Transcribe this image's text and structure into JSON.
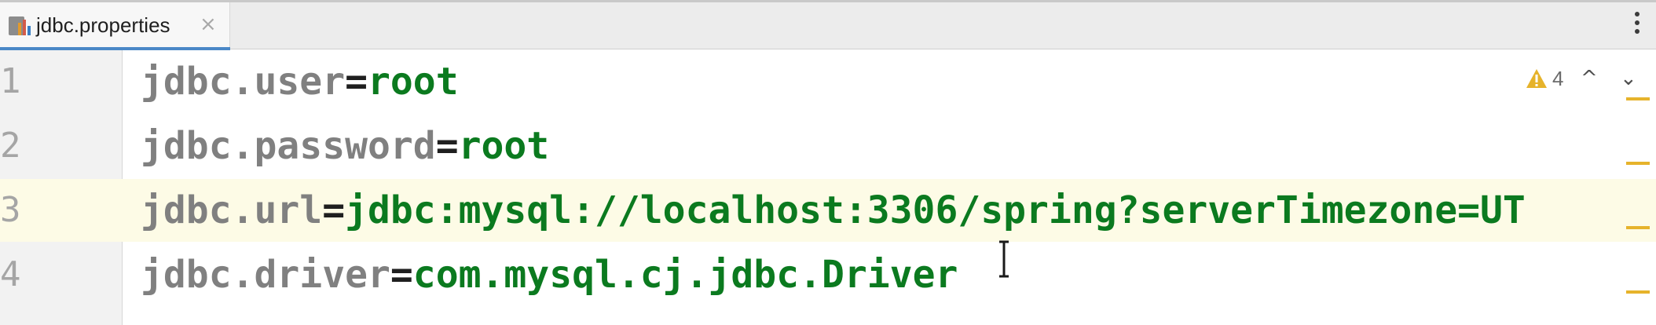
{
  "tab": {
    "title": "jdbc.properties",
    "close_glyph": "×",
    "icon": "properties-file-icon"
  },
  "toolbar": {
    "more_icon": "more-vertical-icon"
  },
  "inspection": {
    "warning_icon": "warning-triangle-icon",
    "warning_count": "4",
    "prev_glyph": "^",
    "next_glyph": "⌄"
  },
  "editor": {
    "current_line": 3,
    "lines": [
      {
        "number": "1",
        "key": "jdbc.user",
        "eq": "=",
        "value": "root"
      },
      {
        "number": "2",
        "key": "jdbc.password",
        "eq": "=",
        "value": "root"
      },
      {
        "number": "3",
        "key": "jdbc.url",
        "eq": "=",
        "value": "jdbc:mysql://localhost:3306/spring?serverTimezone=UT"
      },
      {
        "number": "4",
        "key": "jdbc.driver",
        "eq": "=",
        "value": "com.mysql.cj.jdbc.Driver"
      }
    ]
  },
  "colors": {
    "key": "#808080",
    "value": "#0b7a1f",
    "current_line": "#fdfbe6",
    "tab_underline": "#4a88c7",
    "warning": "#e6b32b"
  }
}
